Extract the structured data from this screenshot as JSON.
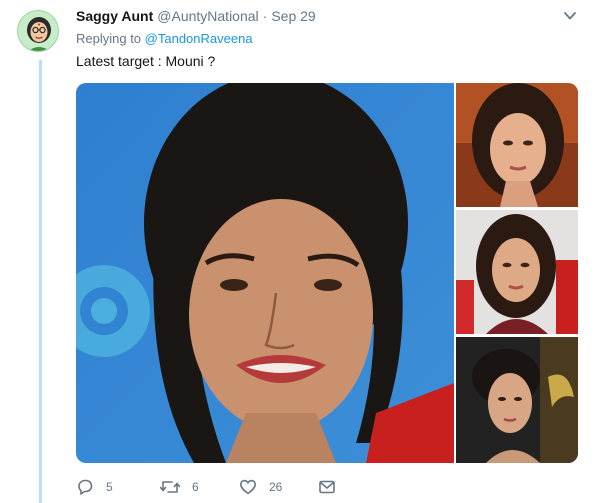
{
  "tweet": {
    "author": {
      "display_name": "Saggy Aunt",
      "handle": "@AuntyNational",
      "separator": "·",
      "date": "Sep 29",
      "avatar": "cartoon-aunt-avatar"
    },
    "reply_prefix": "Replying to",
    "reply_to": "@TandonRaveena",
    "text": "Latest target : Mouni ?",
    "media": [
      {
        "name": "woman-portrait-blue-background"
      },
      {
        "name": "woman-portrait-dark-background"
      },
      {
        "name": "woman-portrait-red-event-backdrop"
      },
      {
        "name": "woman-portrait-event-backdrop"
      }
    ],
    "actions": {
      "reply": {
        "icon": "reply-icon",
        "count": "5"
      },
      "retweet": {
        "icon": "retweet-icon",
        "count": "6"
      },
      "like": {
        "icon": "heart-icon",
        "count": "26"
      },
      "message": {
        "icon": "envelope-icon"
      }
    }
  },
  "colors": {
    "link": "#1b95e0",
    "meta_text": "#657786",
    "thread_line": "#b9def8"
  }
}
